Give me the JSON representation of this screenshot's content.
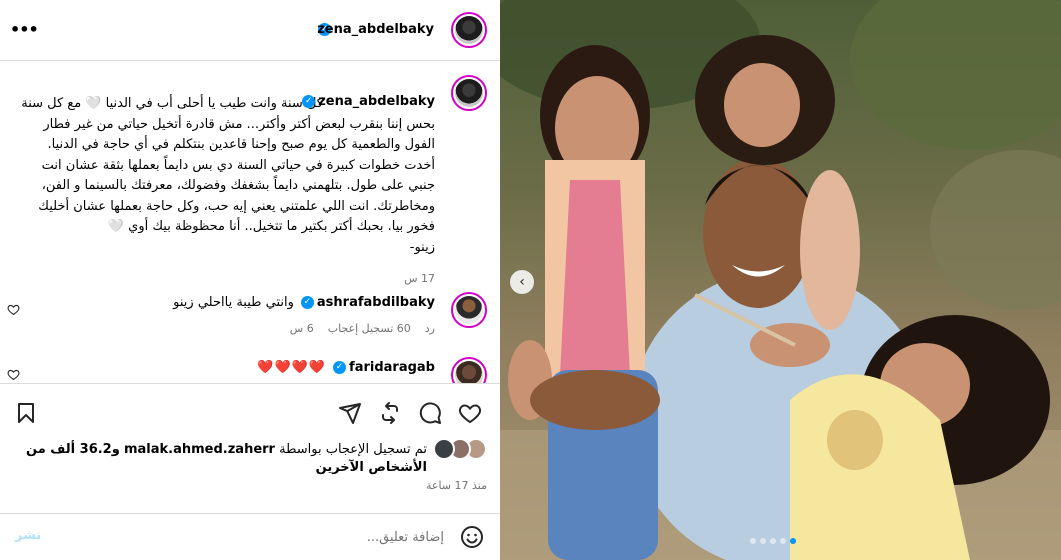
{
  "post": {
    "author": "zena_abdelbaky",
    "more_icon": "more-dots-icon"
  },
  "caption": {
    "username": "zena_abdelbaky",
    "text": "كل سنة وانت طيب يا أحلى أب في الدنيا 🤍 مع كل سنة بحس إننا بنقرب لبعض أكتر وأكتر... مش قادرة أتخيل حياتي من غير فطار الفول والطعمية كل يوم صبح وإحنا قاعدين بنتكلم في أي حاجة في الدنيا. أخدت خطوات كبيرة في حياتي السنة دي بس دايماً بعملها بثقة عشان انت جنبي على طول. بتلهمني دايماً بشغفك وفضولك، معرفتك بالسينما و الفن، ومخاطرتك. انت اللي علمتني يعني إيه حب، وكل حاجة بعملها عشان أخليك فخور بيا. بحبك أكتر بكتير ما تتخيل.. أنا محظوظة بيك أوي 🤍",
    "signature": "زينو-",
    "time": "17 س"
  },
  "comments": [
    {
      "username": "ashrafabdilbaky",
      "text": "وانتي طيبة يااحلي زينو",
      "time": "6 س",
      "likes": "60 تسجيل إعجاب",
      "reply": "رد"
    },
    {
      "username": "faridaragab",
      "text": "❤️❤️❤️❤️"
    }
  ],
  "likes": {
    "prefix": "تم تسجيل الإعجاب بواسطة",
    "user": "malak.ahmed.zaherr",
    "rest": "و36.2 ألف من الأشخاص الآخرين",
    "posted": "منذ 17 ساعة"
  },
  "add_comment": {
    "placeholder": "إضافة تعليق...",
    "post_label": "نشر"
  },
  "colors": {
    "accent": "#0095f6",
    "muted": "#737373",
    "heart": "#ed1c24"
  },
  "carousel": {
    "count": 5,
    "active_index": 4
  }
}
